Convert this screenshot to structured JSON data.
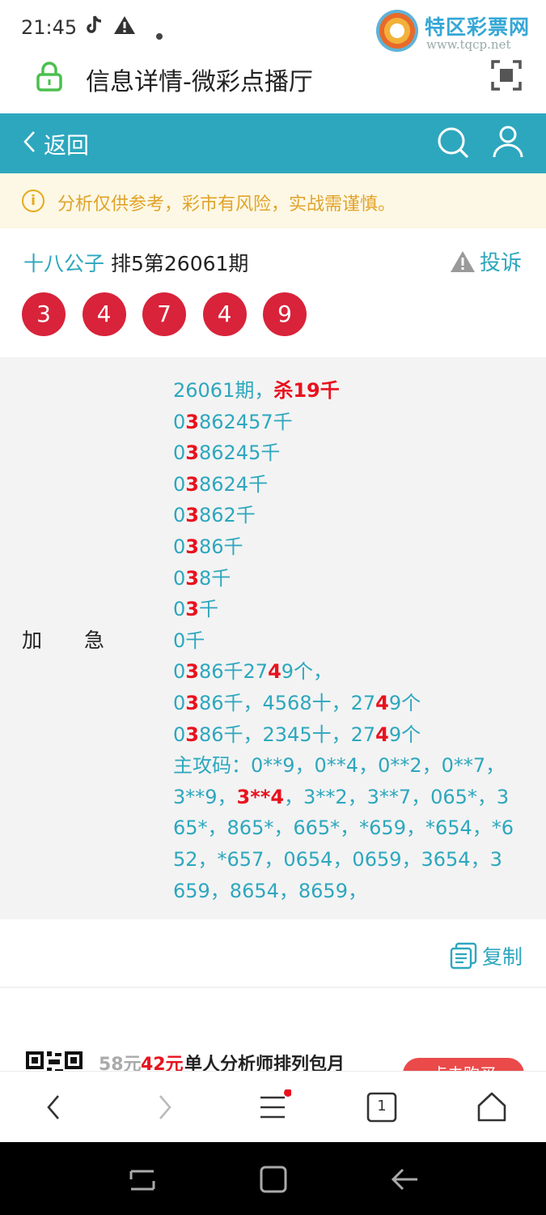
{
  "status_bar": {
    "time": "21:45",
    "icons": [
      "tiktok-icon",
      "warning-icon",
      "dot-icon"
    ],
    "watermark_title": "特区彩票网",
    "watermark_url": "www.tqcp.net"
  },
  "address_bar": {
    "title": "信息详情-微彩点播厅"
  },
  "nav": {
    "back_label": "返回"
  },
  "notice": {
    "icon_glyph": "i",
    "text": "分析仅供参考，彩市有风险，实战需谨慎。"
  },
  "post": {
    "author": "十八公子",
    "period": "排5第26061期",
    "complain_label": "投诉",
    "balls": [
      "3",
      "4",
      "7",
      "4",
      "9"
    ]
  },
  "content": {
    "label": "加急",
    "lines": [
      [
        [
          "26061期，",
          ""
        ],
        [
          "杀19千",
          "red"
        ]
      ],
      [
        [
          "0",
          ""
        ],
        [
          "3",
          "red"
        ],
        [
          "862457千",
          ""
        ]
      ],
      [
        [
          "0",
          ""
        ],
        [
          "3",
          "red"
        ],
        [
          "86245千",
          ""
        ]
      ],
      [
        [
          "0",
          ""
        ],
        [
          "3",
          "red"
        ],
        [
          "8624千",
          ""
        ]
      ],
      [
        [
          "0",
          ""
        ],
        [
          "3",
          "red"
        ],
        [
          "862千",
          ""
        ]
      ],
      [
        [
          "0",
          ""
        ],
        [
          "3",
          "red"
        ],
        [
          "86千",
          ""
        ]
      ],
      [
        [
          "0",
          ""
        ],
        [
          "3",
          "red"
        ],
        [
          "8千",
          ""
        ]
      ],
      [
        [
          "0",
          ""
        ],
        [
          "3",
          "red"
        ],
        [
          "千",
          ""
        ]
      ],
      [
        [
          "0千",
          ""
        ]
      ],
      [
        [
          "0",
          ""
        ],
        [
          "3",
          "red"
        ],
        [
          "86千27",
          ""
        ],
        [
          "4",
          "red"
        ],
        [
          "9个，",
          ""
        ]
      ],
      [
        [
          "0",
          ""
        ],
        [
          "3",
          "red"
        ],
        [
          "86千，4568十，27",
          ""
        ],
        [
          "4",
          "red"
        ],
        [
          "9个",
          ""
        ]
      ],
      [
        [
          "0",
          ""
        ],
        [
          "3",
          "red"
        ],
        [
          "86千，2345十，27",
          ""
        ],
        [
          "4",
          "red"
        ],
        [
          "9个",
          ""
        ]
      ],
      [
        [
          "主攻码：0**9，0**4，0**2，0**7，",
          ""
        ]
      ],
      [
        [
          "3**9，",
          ""
        ],
        [
          "3**4",
          "red"
        ],
        [
          "，3**2，3**7，065*，3",
          ""
        ]
      ],
      [
        [
          "65*，865*，665*，*659，*654，*6",
          ""
        ]
      ],
      [
        [
          "52，*657，0654，0659，3654，3",
          ""
        ]
      ],
      [
        [
          "659，8654，8659，",
          ""
        ]
      ]
    ],
    "copy_label": "复制"
  },
  "promo": {
    "old_price": "58元",
    "new_price": "42元",
    "text": "单人分析师排列包月",
    "button": "点击购买"
  },
  "browser_bar": {
    "tab_count": "1"
  },
  "colors": {
    "accent": "#2da7be",
    "ball": "#d8233a",
    "highlight": "#e8121e",
    "notice_bg": "#fdf8e5",
    "notice_text": "#e1a32a"
  }
}
